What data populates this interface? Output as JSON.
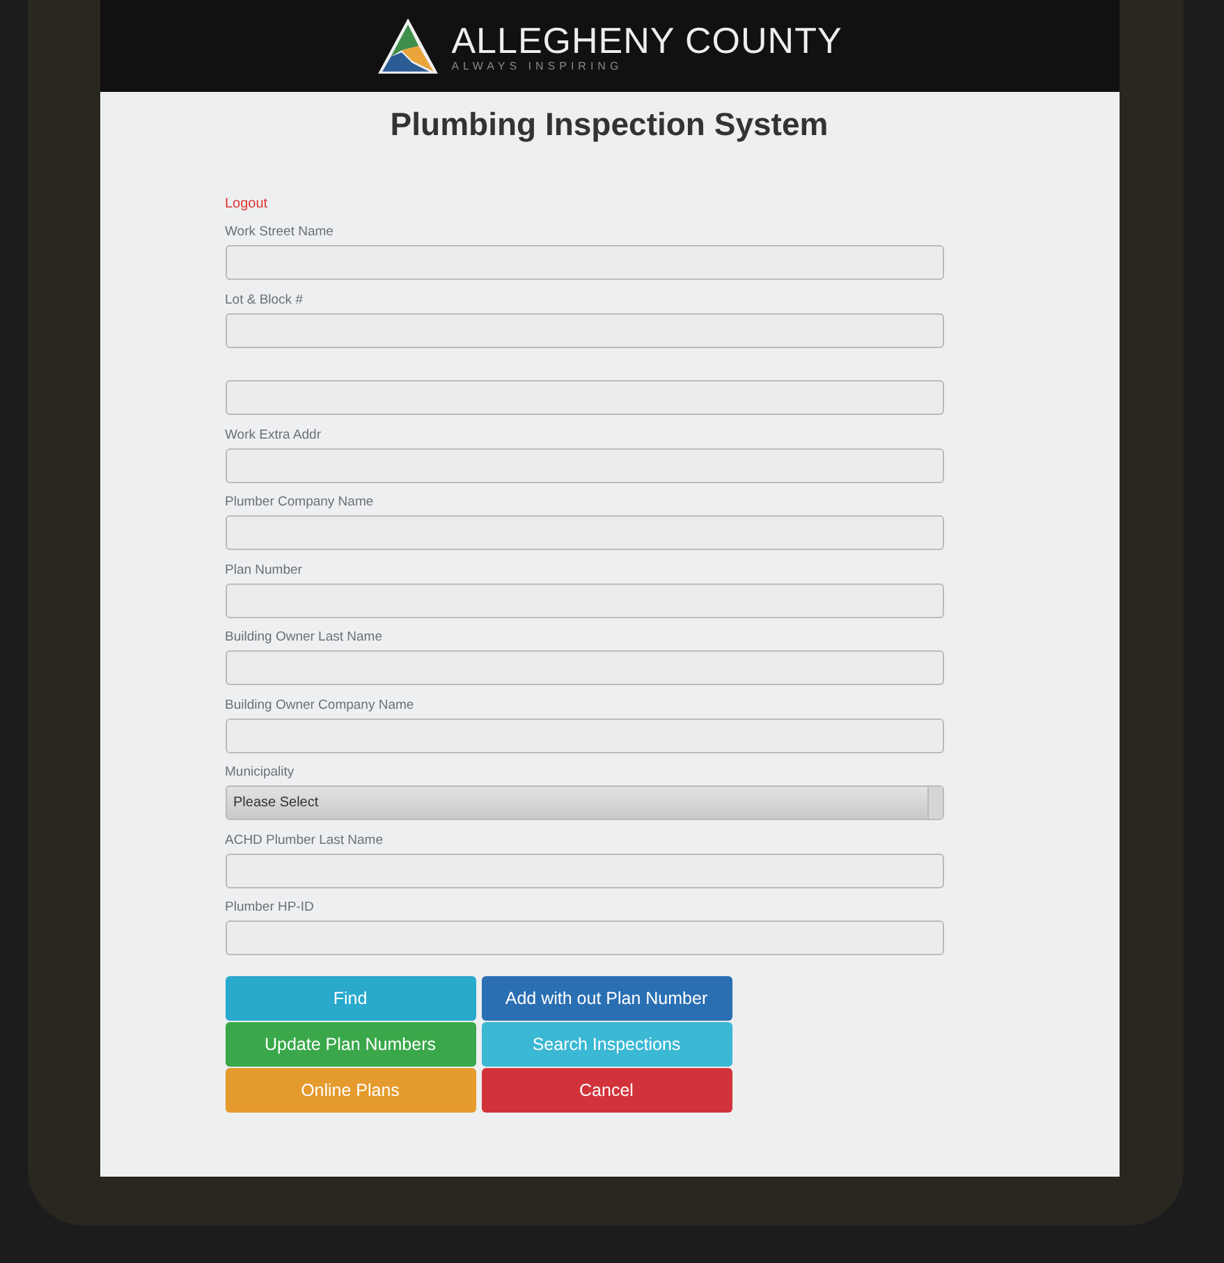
{
  "header": {
    "brand": "ALLEGHENY COUNTY",
    "tagline": "ALWAYS INSPIRING"
  },
  "title": "Plumbing Inspection System",
  "logout": "Logout",
  "fields": [
    {
      "kind": "text",
      "label": "Work Street Name"
    },
    {
      "kind": "text",
      "label": "Lot & Block #"
    },
    {
      "kind": "text"
    },
    {
      "kind": "text",
      "label": "Work Extra Addr"
    },
    {
      "kind": "text",
      "label": "Plumber Company Name"
    },
    {
      "kind": "text",
      "label": "Plan Number"
    },
    {
      "kind": "text",
      "label": "Building Owner Last Name"
    },
    {
      "kind": "text",
      "label": "Building Owner Company Name"
    },
    {
      "kind": "select",
      "label": "Municipality",
      "value": "Please Select"
    },
    {
      "kind": "text",
      "label": "ACHD Plumber Last Name"
    },
    {
      "kind": "text",
      "label": "Plumber HP-ID"
    }
  ],
  "buttons": [
    {
      "label": "Find",
      "color": "#29a9cc"
    },
    {
      "label": "Add with out Plan Number",
      "color": "#2b6fb3"
    },
    {
      "label": "Update Plan Numbers",
      "color": "#3aa84a"
    },
    {
      "label": "Search Inspections",
      "color": "#3bb8d4"
    },
    {
      "label": "Online Plans",
      "color": "#e49a2c"
    },
    {
      "label": "Cancel",
      "color": "#d2333a"
    }
  ]
}
